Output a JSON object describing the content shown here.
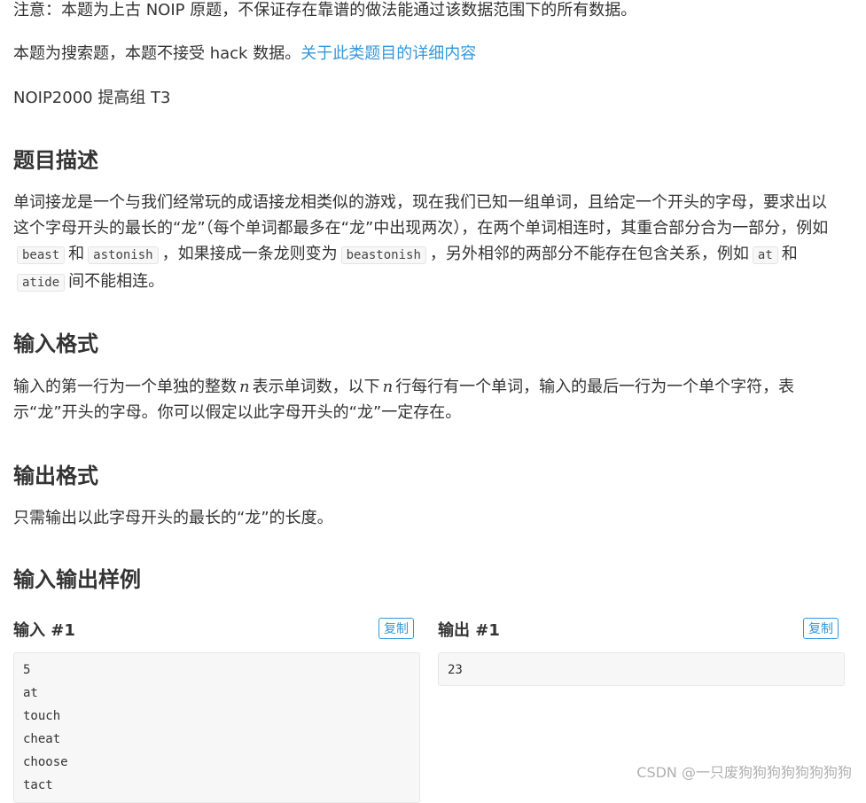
{
  "notice": "注意：本题为上古 NOIP 原题，不保证存在靠谱的做法能通过该数据范围下的所有数据。",
  "search_note": {
    "text": "本题为搜索题，本题不接受 hack 数据。",
    "link": "关于此类题目的详细内容"
  },
  "source": "NOIP2000 提高组 T3",
  "description": {
    "heading": "题目描述",
    "t1": "单词接龙是一个与我们经常玩的成语接龙相类似的游戏，现在我们已知一组单词，且给定一个开头的字母，要求出以这个字母开头的最长的“龙”（每个单词都最多在“龙”中出现两次），在两个单词相连时，其重合部分合为一部分，例如",
    "c1": "beast",
    "t2": "和",
    "c2": "astonish",
    "t3": "，如果接成一条龙则变为",
    "c3": "beastonish",
    "t4": "，另外相邻的两部分不能存在包含关系，例如",
    "c4": "at",
    "t5": "和",
    "c5": "atide",
    "t6": "间不能相连。"
  },
  "input_format": {
    "heading": "输入格式",
    "t1": "输入的第一行为一个单独的整数",
    "var1": "n",
    "t2": "表示单词数，以下",
    "var2": "n",
    "t3": "行每行有一个单词，输入的最后一行为一个单个字符，表示“龙”开头的字母。你可以假定以此字母开头的“龙”一定存在。"
  },
  "output_format": {
    "heading": "输出格式",
    "text": "只需输出以此字母开头的最长的“龙”的长度。"
  },
  "samples": {
    "heading": "输入输出样例",
    "input_title": "输入 #1",
    "output_title": "输出 #1",
    "copy_label": "复制",
    "input_lines": [
      "5",
      "at",
      "touch",
      "cheat",
      "choose",
      "tact"
    ],
    "output_lines": [
      "23"
    ]
  },
  "watermark": "CSDN @一只废狗狗狗狗狗狗狗狗"
}
